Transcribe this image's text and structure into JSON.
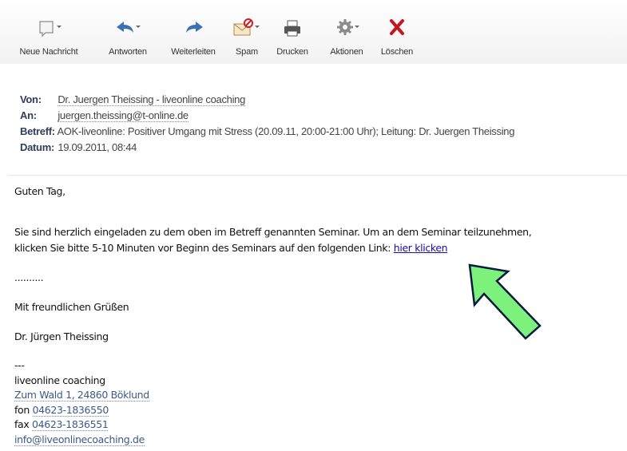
{
  "toolbar": {
    "new_message": "Neue Nachricht",
    "reply": "Antworten",
    "forward": "Weiterleiten",
    "spam": "Spam",
    "print": "Drucken",
    "actions": "Aktionen",
    "delete": "Löschen"
  },
  "headers": {
    "from_label": "Von:",
    "from_value": "Dr. Juergen Theissing - liveonline coaching",
    "to_label": "An:",
    "to_value": "juergen.theissing@t-online.de",
    "subject_label": "Betreff:",
    "subject_value": "AOK-liveonline: Positiver Umgang mit Stress (20.09.11, 20:00-21:00 Uhr); Leitung: Dr. Juergen Theissing",
    "date_label": "Datum:",
    "date_value": "19.09.2011, 08:44"
  },
  "body": {
    "greeting": "Guten Tag,",
    "line1": "Sie sind herzlich eingeladen zu dem oben im Betreff genannten Seminar. Um an dem Seminar teilzunehmen,",
    "line2": "klicken Sie bitte 5-10 Minuten vor Beginn des Seminars auf den folgenden Link: ",
    "link": "hier klicken",
    "dots": "..........",
    "closing": "Mit freundlichen Grüßen",
    "name": "Dr. Jürgen Theissing",
    "sep": "---",
    "company": "liveonline coaching",
    "address": "Zum Wald 1, 24860 Böklund",
    "fon_label": "fon ",
    "fon": "04623-1836550",
    "fax_label": "fax ",
    "fax": "04623-1836551",
    "email": "info@liveonlinecoaching.de"
  },
  "colors": {
    "arrow_fill": "#7cf27c",
    "delete_red": "#c8141e",
    "reply_blue": "#3d6fb5",
    "link": "#1a0dab"
  }
}
